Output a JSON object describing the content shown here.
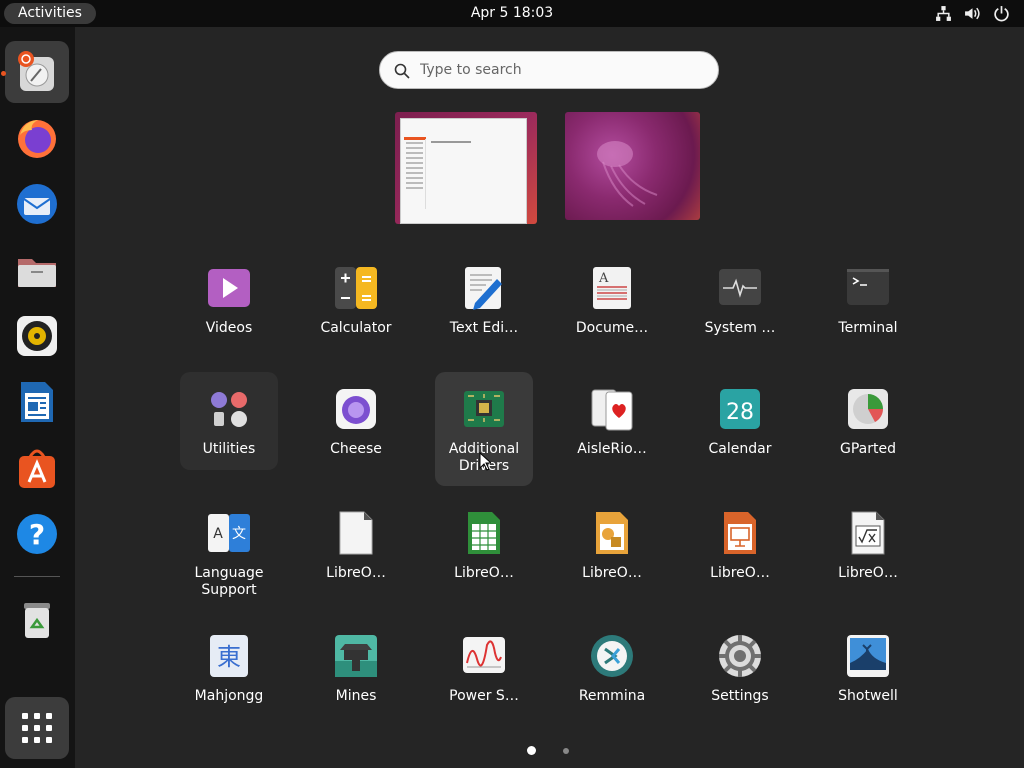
{
  "topbar": {
    "activities": "Activities",
    "clock": "Apr 5  18:03"
  },
  "dock": {
    "items": [
      {
        "name": "Ubuntu Desktop Installer",
        "icon": "installer-icon",
        "active": true
      },
      {
        "name": "Firefox",
        "icon": "firefox-icon"
      },
      {
        "name": "Thunderbird",
        "icon": "thunderbird-icon"
      },
      {
        "name": "Files",
        "icon": "files-icon"
      },
      {
        "name": "Rhythmbox",
        "icon": "rhythmbox-icon"
      },
      {
        "name": "LibreOffice Writer",
        "icon": "writer-icon"
      },
      {
        "name": "Ubuntu Software",
        "icon": "software-icon"
      },
      {
        "name": "Help",
        "icon": "help-icon"
      },
      {
        "name": "Trash",
        "icon": "trash-icon"
      },
      {
        "name": "Show Applications",
        "icon": "app-grid-icon"
      }
    ]
  },
  "search": {
    "placeholder": "Type to search"
  },
  "apps": {
    "row1": [
      "Videos",
      "Calculator",
      "Text Edi…",
      "Docume…",
      "System …",
      "Terminal"
    ],
    "row2": [
      "Utilities",
      "Cheese",
      "Additional Drivers",
      "AisleRio…",
      "Calendar",
      "GParted"
    ],
    "row3": [
      "Language Support",
      "LibreO…",
      "LibreO…",
      "LibreO…",
      "LibreO…",
      "LibreO…"
    ],
    "row4": [
      "Mahjongg",
      "Mines",
      "Power S…",
      "Remmina",
      "Settings",
      "Shotwell"
    ],
    "calendar_day": "28"
  },
  "colors": {
    "accent": "#e95420",
    "topbar": "#0d0d0d",
    "dock": "#141414",
    "background": "#252525"
  }
}
